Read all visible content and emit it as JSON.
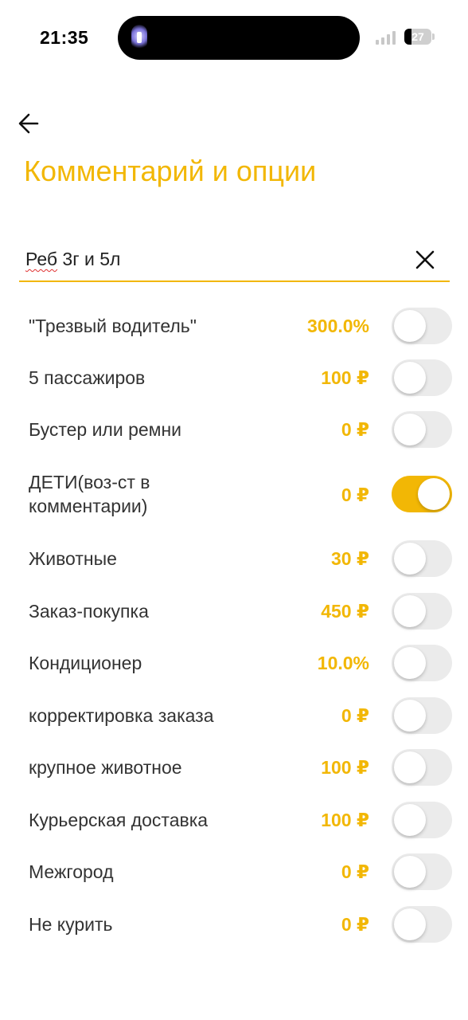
{
  "status_bar": {
    "time": "21:35",
    "battery": "27"
  },
  "header": {
    "title": "Комментарий и опции"
  },
  "comment": {
    "value_word1": "Реб",
    "value_rest": " 3г и 5л"
  },
  "options": [
    {
      "label": "\"Трезвый водитель\"",
      "price": "300.0%",
      "enabled": false
    },
    {
      "label": "5 пассажиров",
      "price": "100 ₽",
      "enabled": false
    },
    {
      "label": "Бустер или ремни",
      "price": "0 ₽",
      "enabled": false
    },
    {
      "label": "ДЕТИ(воз-ст в комментарии)",
      "price": "0 ₽",
      "enabled": true
    },
    {
      "label": "Животные",
      "price": "30 ₽",
      "enabled": false
    },
    {
      "label": "Заказ-покупка",
      "price": "450 ₽",
      "enabled": false
    },
    {
      "label": "Кондиционер",
      "price": "10.0%",
      "enabled": false
    },
    {
      "label": "корректировка заказа",
      "price": "0 ₽",
      "enabled": false
    },
    {
      "label": "крупное животное",
      "price": "100 ₽",
      "enabled": false
    },
    {
      "label": "Курьерская доставка",
      "price": "100 ₽",
      "enabled": false
    },
    {
      "label": "Межгород",
      "price": "0 ₽",
      "enabled": false
    },
    {
      "label": "Не курить",
      "price": "0 ₽",
      "enabled": false
    }
  ],
  "colors": {
    "accent": "#f2b705",
    "toggle_off": "#ebebeb"
  },
  "icons": {
    "back": "arrow-left-icon",
    "clear": "close-icon",
    "flashlight": "flashlight-icon",
    "signal": "signal-icon",
    "battery": "battery-icon"
  }
}
